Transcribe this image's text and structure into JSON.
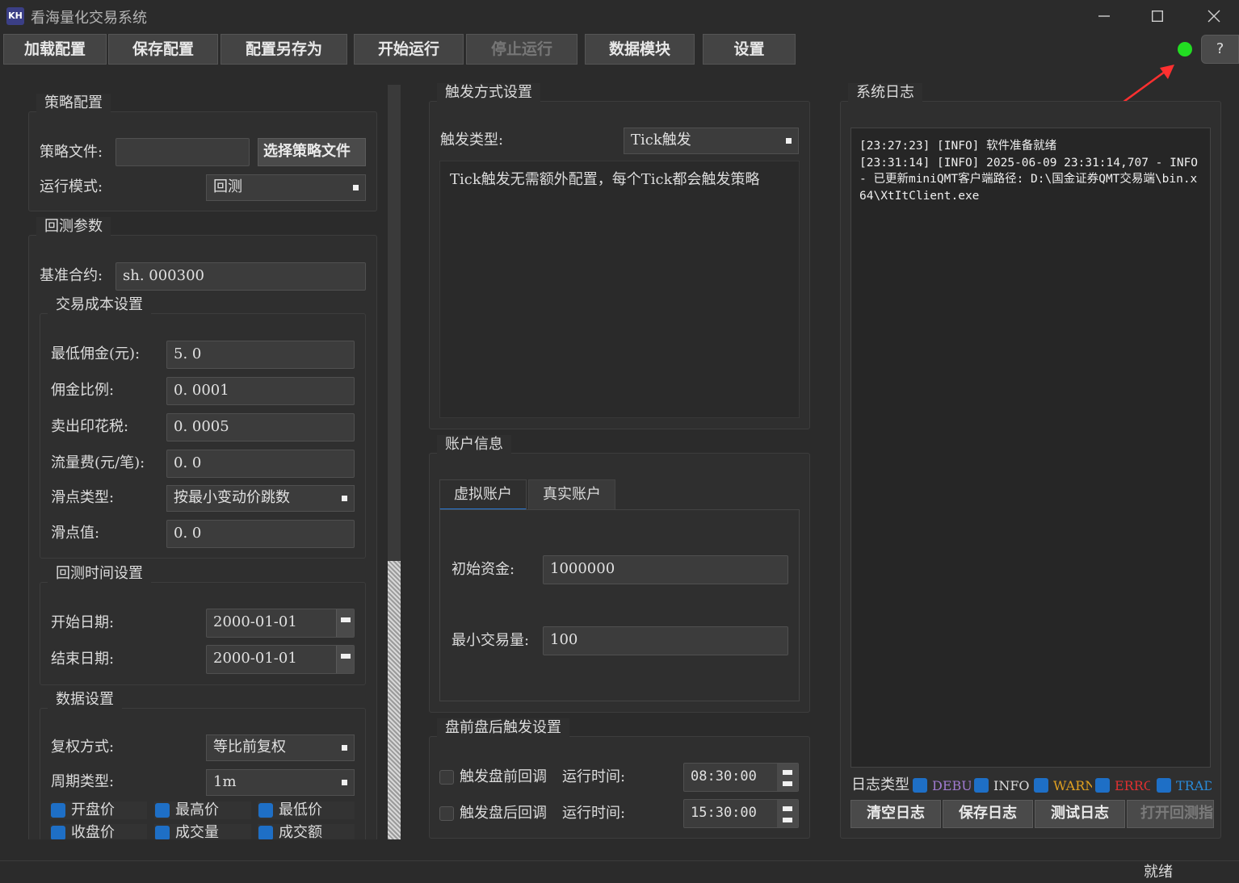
{
  "window": {
    "logo": "KH",
    "title": "看海量化交易系统",
    "minimize_icon": "minimize-icon",
    "maximize_icon": "maximize-icon",
    "close_icon": "close-icon"
  },
  "toolbar": {
    "load": "加载配置",
    "save": "保存配置",
    "save_as": "配置另存为",
    "start": "开始运行",
    "stop": "停止运行",
    "data_module": "数据模块",
    "settings": "设置",
    "help": "?",
    "status_color": "#22dd22"
  },
  "strategy": {
    "title": "策略配置",
    "file_label": "策略文件:",
    "file_value": "",
    "choose_btn": "选择策略文件",
    "mode_label": "运行模式:",
    "mode_value": "回测"
  },
  "backtest": {
    "title": "回测参数",
    "benchmark_label": "基准合约:",
    "benchmark_value": "sh. 000300",
    "cost": {
      "title": "交易成本设置",
      "min_comm_label": "最低佣金(元):",
      "min_comm": "5. 0",
      "comm_rate_label": "佣金比例:",
      "comm_rate": "0. 0001",
      "stamp_label": "卖出印花税:",
      "stamp": "0. 0005",
      "flow_label": "流量费(元/笔):",
      "flow": "0. 0",
      "slip_type_label": "滑点类型:",
      "slip_type": "按最小变动价跳数",
      "slip_value_label": "滑点值:",
      "slip_value": "0. 0"
    },
    "time": {
      "title": "回测时间设置",
      "start_label": "开始日期:",
      "start": "2000-01-01",
      "end_label": "结束日期:",
      "end": "2000-01-01"
    },
    "data": {
      "title": "数据设置",
      "adjust_label": "复权方式:",
      "adjust": "等比前复权",
      "period_label": "周期类型:",
      "period": "1m",
      "fields": [
        "开盘价",
        "最高价",
        "最低价",
        "收盘价",
        "成交量",
        "成交额"
      ]
    }
  },
  "trigger": {
    "title": "触发方式设置",
    "type_label": "触发类型:",
    "type_value": "Tick触发",
    "desc": "Tick触发无需额外配置，每个Tick都会触发策略"
  },
  "account": {
    "title": "账户信息",
    "tab_virtual": "虚拟账户",
    "tab_real": "真实账户",
    "capital_label": "初始资金:",
    "capital": "1000000",
    "min_vol_label": "最小交易量:",
    "min_vol": "100"
  },
  "prepost": {
    "title": "盘前盘后触发设置",
    "pre_label": "触发盘前回调",
    "pre_time_label": "运行时间:",
    "pre_time": "08:30:00",
    "post_label": "触发盘后回调",
    "post_time_label": "运行时间:",
    "post_time": "15:30:00"
  },
  "syslog": {
    "title": "系统日志",
    "lines": [
      "[23:27:23] [INFO] 软件准备就绪",
      "[23:31:14] [INFO] 2025-06-09 23:31:14,707 - INFO - 已更新miniQMT客户端路径: D:\\国金证券QMT交易端\\bin.x64\\XtItClient.exe"
    ],
    "type_label": "日志类型",
    "filters": [
      {
        "label": "DEBUG",
        "color": "#a07ad0"
      },
      {
        "label": "INFO",
        "color": "#dcdcdc"
      },
      {
        "label": "WARN",
        "color": "#e0a020"
      },
      {
        "label": "ERROR",
        "color": "#e03030"
      },
      {
        "label": "TRADE",
        "color": "#2a8ad8"
      }
    ],
    "clear": "清空日志",
    "save": "保存日志",
    "test": "测试日志",
    "open_report": "打开回测指标"
  },
  "status": {
    "text": "就绪"
  }
}
